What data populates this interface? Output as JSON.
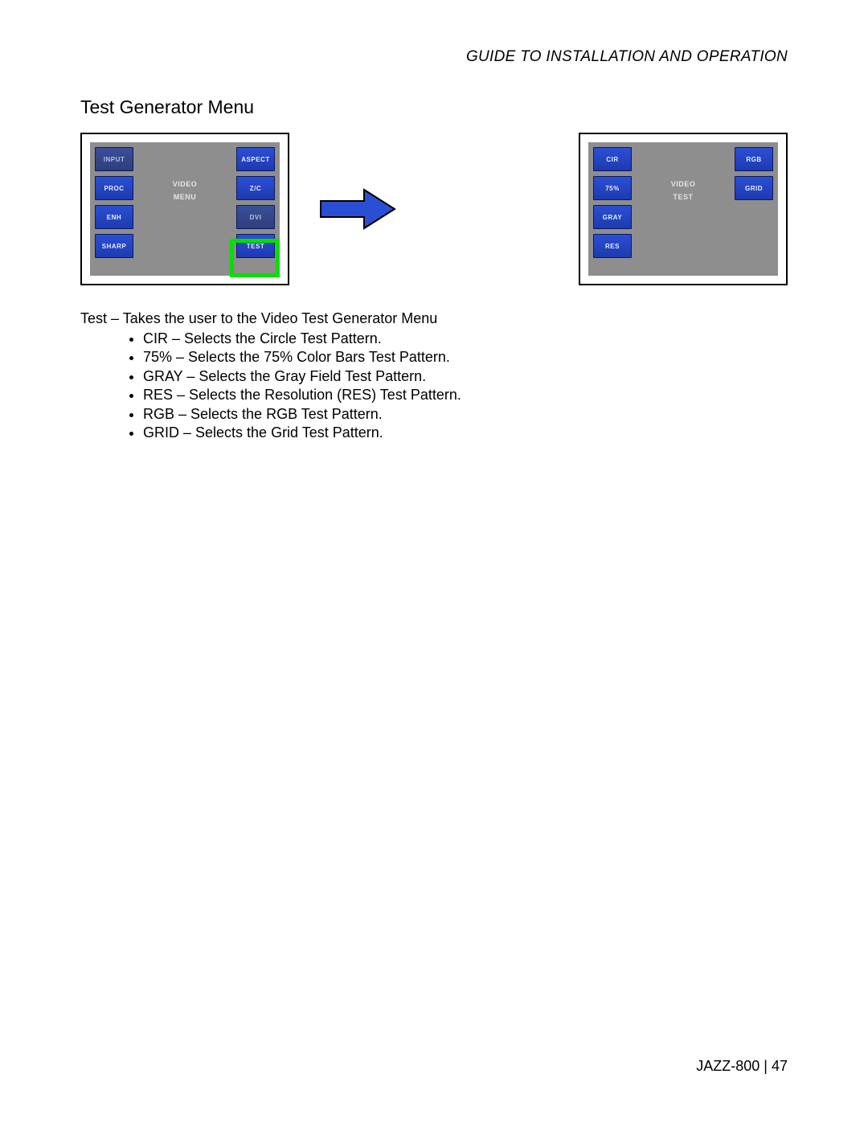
{
  "header": {
    "guide": "GUIDE TO INSTALLATION AND OPERATION"
  },
  "section": {
    "title": "Test Generator Menu"
  },
  "left_screen": {
    "left_buttons": [
      "INPUT",
      "PROC",
      "ENH",
      "SHARP"
    ],
    "right_buttons": [
      "ASPECT",
      "Z/C",
      "DVI",
      "TEST"
    ],
    "center_top": "VIDEO",
    "center_bottom": "MENU"
  },
  "right_screen": {
    "left_buttons": [
      "CIR",
      "75%",
      "GRAY",
      "RES"
    ],
    "right_buttons": [
      "RGB",
      "GRID"
    ],
    "center_top": "VIDEO",
    "center_bottom": "TEST"
  },
  "body": {
    "intro": "Test – Takes the user to the Video Test Generator Menu",
    "bullets": [
      "CIR – Selects the Circle Test Pattern.",
      "75% – Selects the 75% Color Bars Test Pattern.",
      "GRAY – Selects the Gray Field Test Pattern.",
      "RES – Selects the Resolution (RES) Test Pattern.",
      "RGB – Selects the RGB Test Pattern.",
      "GRID – Selects the Grid Test Pattern."
    ]
  },
  "footer": {
    "model": "JAZZ-800",
    "sep": "  |  ",
    "page": "47"
  }
}
